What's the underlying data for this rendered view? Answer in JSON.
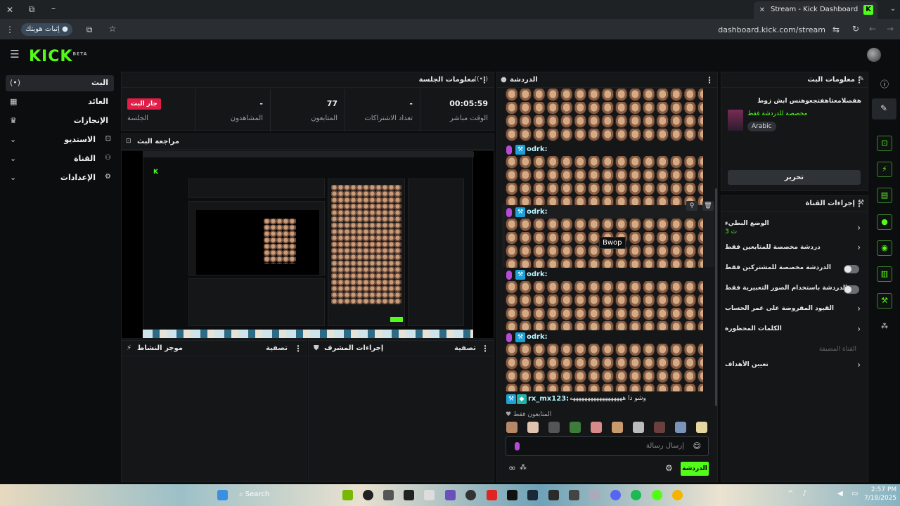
{
  "browser": {
    "tab_title": "Stream - Kick Dashboard",
    "tab_favicon": "K",
    "url": "dashboard.kick.com/stream",
    "verify_label": "إثبات هويتك"
  },
  "header": {
    "logo": "KICK",
    "logo_sup": "BETA"
  },
  "sidebar": {
    "items": [
      {
        "label": "البث",
        "icon": "live-icon",
        "active": true
      },
      {
        "label": "العائد",
        "icon": "revenue-icon"
      },
      {
        "label": "الإنجازات",
        "icon": "trophy-icon"
      },
      {
        "label": "الاستديو",
        "icon": "studio-icon",
        "expandable": true
      },
      {
        "label": "القناة",
        "icon": "channel-icon",
        "expandable": true
      },
      {
        "label": "الإعدادات",
        "icon": "settings-icon",
        "expandable": true
      }
    ]
  },
  "session": {
    "title": "معلومات الجلسة",
    "stats": [
      {
        "value": "00:05:59",
        "label": "الوقت مباشر"
      },
      {
        "value": "-",
        "label": "تعداد الاشتراكات"
      },
      {
        "value": "77",
        "label": "المتابعون"
      },
      {
        "value": "-",
        "label": "المشاهدون"
      },
      {
        "value": "جار البث",
        "label": "الجلسة",
        "badge": true
      }
    ]
  },
  "preview": {
    "title": "مراجعة البث"
  },
  "activity": {
    "title": "موجز النشاط",
    "filter": "تصفية"
  },
  "mod_actions": {
    "title": "إجراءات المشرف",
    "filter": "تصفية"
  },
  "chat": {
    "title": "الدردشة",
    "messages": [
      {
        "user": "odrk:"
      },
      {
        "user": "odrk:"
      },
      {
        "user": "odrk:"
      },
      {
        "user": "odrk:"
      },
      {
        "user": "rx_mx123:",
        "text": "وشو ذا ههههههههههههههههههه"
      }
    ],
    "tooltip": "Bwop",
    "followers_only_label": "المتابعون فقط",
    "input_placeholder": "إرسال رسالة",
    "send_label": "الدردشة"
  },
  "stream_info": {
    "title": "معلومات البث",
    "stream_title": "هفصلامعتاهفتجعوهنس ابش زوط",
    "category": "مخصصة للدردشة فقط",
    "language": "Arabic",
    "edit_label": "تحرير"
  },
  "channel_actions": {
    "title": "إجراءات القناة",
    "items": [
      {
        "label": "الوضع البطيء",
        "sub": "3 ث",
        "control": "chevron"
      },
      {
        "label": "دردشة مخصصة للمتابعين فقط",
        "control": "chevron"
      },
      {
        "label": "الدردشة مخصصة للمشتركين فقط",
        "control": "toggle"
      },
      {
        "label": "الدردشة باستخدام الصور التعبيرية فقط",
        "control": "toggle"
      },
      {
        "label": "القيود المفروضة على عمر الحساب",
        "control": "chevron"
      },
      {
        "label": "الكلمات المحظورة",
        "control": "chevron"
      },
      {
        "label": "القناة المضيفة",
        "control": "none",
        "muted": true
      },
      {
        "label": "تعيين الأهداف",
        "control": "chevron"
      }
    ]
  },
  "taskbar": {
    "search_placeholder": "Search",
    "time": "2:57 PM",
    "date": "7/18/2025"
  },
  "colors": {
    "accent": "#53fc18",
    "live": "#e11d48",
    "background": "#0b0d0f",
    "panel": "#141618"
  }
}
